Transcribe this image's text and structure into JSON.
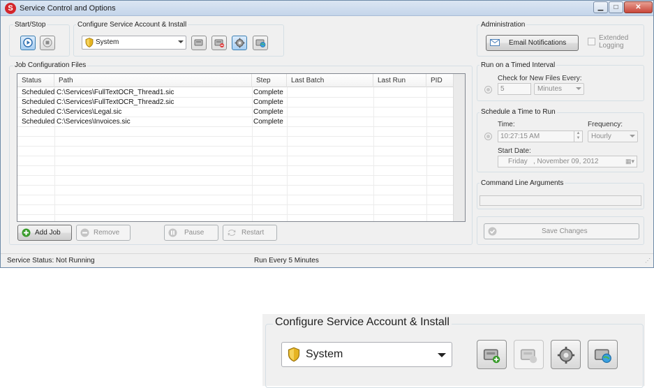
{
  "window": {
    "title": "Service Control and Options",
    "min_glyph": "▁",
    "max_glyph": "□",
    "close_glyph": "✕"
  },
  "start_stop": {
    "label": "Start/Stop"
  },
  "configure": {
    "label": "Configure Service Account & Install",
    "account": "System"
  },
  "administration": {
    "label": "Administration",
    "email_button": "Email Notifications",
    "extended_logging": "Extended Logging"
  },
  "jobs": {
    "label": "Job Configuration Files",
    "columns": [
      "Status",
      "Path",
      "Step",
      "Last Batch",
      "Last Run",
      "PID"
    ],
    "rows": [
      {
        "status": "Scheduled",
        "path": "C:\\Services\\FullTextOCR_Thread1.sic",
        "step": "Complete",
        "last_batch": "",
        "last_run": "",
        "pid": ""
      },
      {
        "status": "Scheduled",
        "path": "C:\\Services\\FullTextOCR_Thread2.sic",
        "step": "Complete",
        "last_batch": "",
        "last_run": "",
        "pid": ""
      },
      {
        "status": "Scheduled",
        "path": "C:\\Services\\Legal.sic",
        "step": "Complete",
        "last_batch": "",
        "last_run": "",
        "pid": ""
      },
      {
        "status": "Scheduled",
        "path": "C:\\Services\\Invoices.sic",
        "step": "Complete",
        "last_batch": "",
        "last_run": "",
        "pid": ""
      }
    ],
    "buttons": {
      "add": "Add Job",
      "remove": "Remove",
      "pause": "Pause",
      "restart": "Restart"
    }
  },
  "timed_interval": {
    "label": "Run on a Timed Interval",
    "check_label": "Check for New Files Every:",
    "value": "5",
    "unit": "Minutes"
  },
  "schedule": {
    "label": "Schedule a Time to Run",
    "time_label": "Time:",
    "time_value": "10:27:15 AM",
    "frequency_label": "Frequency:",
    "frequency_value": "Hourly",
    "start_date_label": "Start Date:",
    "start_date_day": "Friday",
    "start_date_value": ", November 09, 2012"
  },
  "command_line": {
    "label": "Command Line Arguments",
    "value": ""
  },
  "save_button": "Save Changes",
  "status_bar": {
    "service_status": "Service Status: Not Running",
    "run_every": "Run Every 5 Minutes"
  },
  "zoom": {
    "label": "Configure Service Account & Install",
    "account": "System"
  },
  "colors": {
    "accent_blue": "#3c7fb1",
    "add_green": "#3a9c2c",
    "app_red": "#d4262c"
  },
  "icons": [
    "app-logo-icon",
    "play-icon",
    "stop-icon",
    "shield-icon",
    "install-service-icon",
    "uninstall-service-icon",
    "settings-gear-icon",
    "service-globe-icon",
    "envelope-icon",
    "add-icon",
    "remove-icon",
    "pause-icon",
    "restart-icon",
    "check-icon"
  ]
}
